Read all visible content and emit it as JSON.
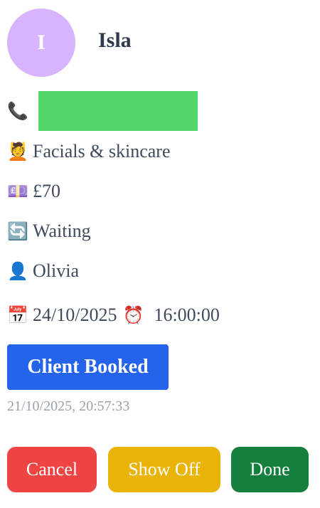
{
  "client": {
    "initial": "I",
    "name": "Isla",
    "avatar_color": "#d8b4fe"
  },
  "details": {
    "phone": {
      "icon": "phone-icon",
      "glyph": "📞",
      "value": "",
      "mask_color": "#55d66b"
    },
    "service": {
      "icon": "face-massage-icon",
      "glyph": "💆",
      "value": "Facials & skincare"
    },
    "price": {
      "icon": "banknote-icon",
      "glyph": "💷",
      "value": "£70"
    },
    "status": {
      "icon": "refresh-icon",
      "glyph": "🔄",
      "value": "Waiting"
    },
    "staff": {
      "icon": "person-icon",
      "glyph": "👤",
      "value": "Olivia"
    },
    "appointment": {
      "calendar_icon": "calendar-icon",
      "calendar_glyph": "📅",
      "date": "24/10/2025",
      "clock_icon": "alarm-clock-icon",
      "clock_glyph": "⏰",
      "time": "16:00:00"
    }
  },
  "booking": {
    "button_label": "Client Booked",
    "button_color": "#2563eb",
    "timestamp": "21/10/2025, 20:57:33"
  },
  "actions": {
    "cancel": {
      "label": "Cancel",
      "color": "#ef4444"
    },
    "show_off": {
      "label": "Show Off",
      "color": "#eab308"
    },
    "done": {
      "label": "Done",
      "color": "#15803d"
    }
  }
}
